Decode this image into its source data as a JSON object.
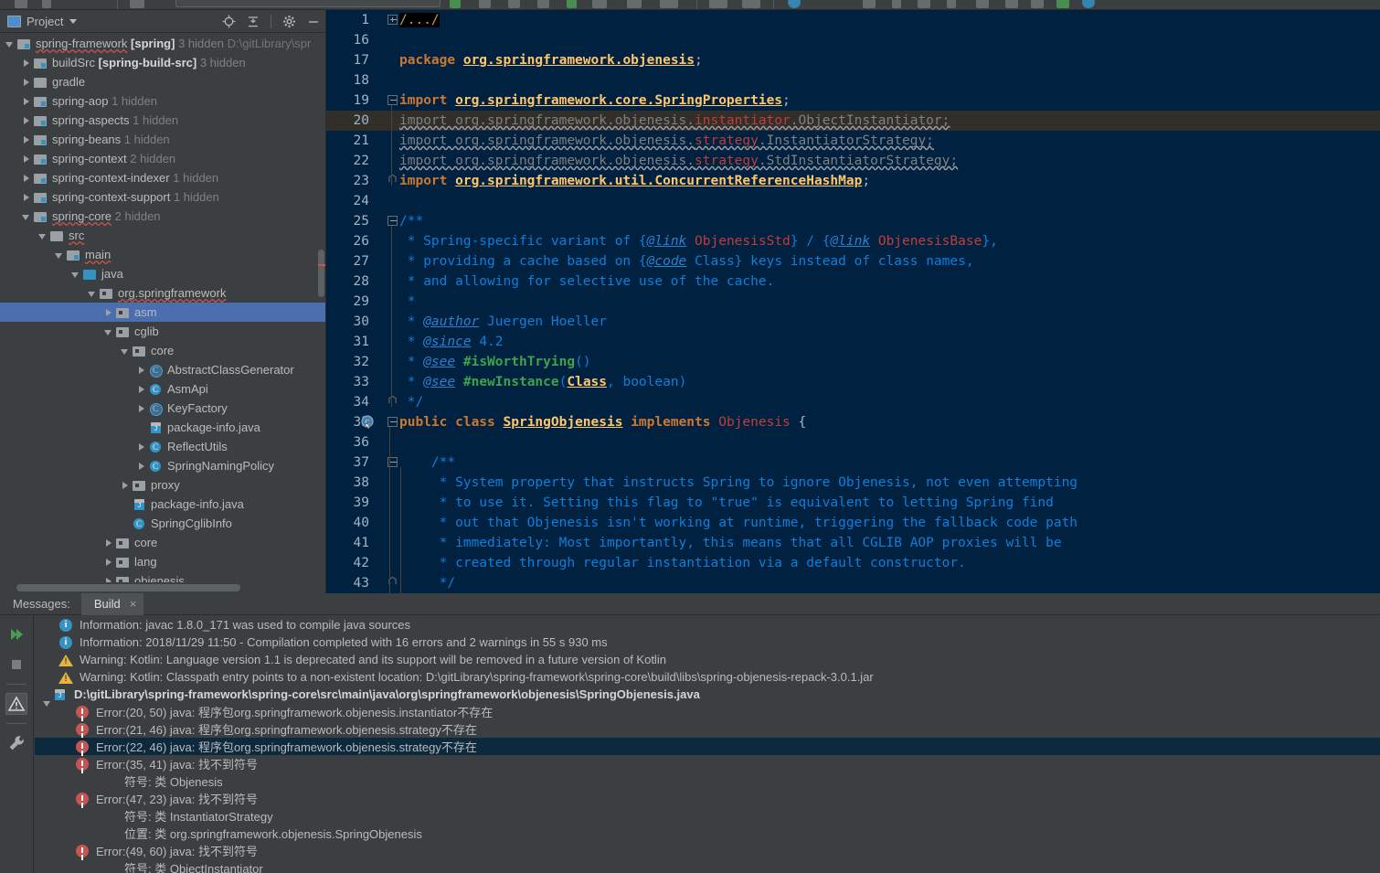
{
  "project_panel": {
    "title": "Project",
    "icons": [
      "project-window-icon",
      "caret-down-icon",
      "locate-icon",
      "collapse-all-icon",
      "gear-icon",
      "hide-icon"
    ],
    "tree": [
      {
        "depth": 0,
        "state": "open",
        "icon": "module-icon",
        "name": "spring-framework",
        "bracket": "[spring]",
        "hidden": "3 hidden",
        "path": "D:\\gitLibrary\\spr",
        "squiggle": true
      },
      {
        "depth": 1,
        "state": "closed",
        "icon": "module-icon",
        "name": "buildSrc",
        "bracket": "[spring-build-src]",
        "hidden": "3 hidden"
      },
      {
        "depth": 1,
        "state": "closed",
        "icon": "folder-icon",
        "name": "gradle"
      },
      {
        "depth": 1,
        "state": "closed",
        "icon": "module-icon",
        "name": "spring-aop",
        "hidden": "1 hidden"
      },
      {
        "depth": 1,
        "state": "closed",
        "icon": "module-icon",
        "name": "spring-aspects",
        "hidden": "1 hidden"
      },
      {
        "depth": 1,
        "state": "closed",
        "icon": "module-icon",
        "name": "spring-beans",
        "hidden": "1 hidden"
      },
      {
        "depth": 1,
        "state": "closed",
        "icon": "module-icon",
        "name": "spring-context",
        "hidden": "2 hidden"
      },
      {
        "depth": 1,
        "state": "closed",
        "icon": "module-icon",
        "name": "spring-context-indexer",
        "hidden": "1 hidden"
      },
      {
        "depth": 1,
        "state": "closed",
        "icon": "module-icon",
        "name": "spring-context-support",
        "hidden": "1 hidden"
      },
      {
        "depth": 1,
        "state": "open",
        "icon": "module-icon",
        "name": "spring-core",
        "hidden": "2 hidden",
        "squiggle": true
      },
      {
        "depth": 2,
        "state": "open",
        "icon": "folder-icon",
        "name": "src",
        "squiggle": true
      },
      {
        "depth": 3,
        "state": "open",
        "icon": "module-icon",
        "name": "main",
        "squiggle": true
      },
      {
        "depth": 4,
        "state": "open",
        "icon": "folder-blue-icon",
        "name": "java"
      },
      {
        "depth": 5,
        "state": "open",
        "icon": "package-icon",
        "name": "org.springframework",
        "squiggle": true
      },
      {
        "depth": 6,
        "state": "closed",
        "icon": "package-icon",
        "name": "asm",
        "selected": true
      },
      {
        "depth": 6,
        "state": "open",
        "icon": "package-icon",
        "name": "cglib"
      },
      {
        "depth": 7,
        "state": "open",
        "icon": "package-icon",
        "name": "core"
      },
      {
        "depth": 8,
        "state": "closed",
        "icon": "class-abstract-icon",
        "name": "AbstractClassGenerator"
      },
      {
        "depth": 8,
        "state": "closed",
        "icon": "class-icon",
        "name": "AsmApi"
      },
      {
        "depth": 8,
        "state": "closed",
        "icon": "class-abstract-icon",
        "name": "KeyFactory"
      },
      {
        "depth": 8,
        "state": "none",
        "icon": "java-file-icon",
        "name": "package-info.java"
      },
      {
        "depth": 8,
        "state": "closed",
        "icon": "class-icon",
        "name": "ReflectUtils"
      },
      {
        "depth": 8,
        "state": "closed",
        "icon": "class-icon",
        "name": "SpringNamingPolicy"
      },
      {
        "depth": 7,
        "state": "closed",
        "icon": "package-icon",
        "name": "proxy"
      },
      {
        "depth": 7,
        "state": "none",
        "icon": "java-file-icon",
        "name": "package-info.java"
      },
      {
        "depth": 7,
        "state": "none",
        "icon": "class-icon",
        "name": "SpringCglibInfo"
      },
      {
        "depth": 6,
        "state": "closed",
        "icon": "package-icon",
        "name": "core"
      },
      {
        "depth": 6,
        "state": "closed",
        "icon": "package-icon",
        "name": "lang"
      },
      {
        "depth": 6,
        "state": "closed",
        "icon": "package-icon",
        "name": "objenesis",
        "squiggle": true
      }
    ]
  },
  "editor": {
    "file": "SpringObjenesis.java",
    "current_line": 20,
    "lines": [
      {
        "num": "1",
        "fold": "plus",
        "segments": [
          {
            "t": "/.../",
            "c": "fold-ph"
          }
        ]
      },
      {
        "num": "16",
        "segments": []
      },
      {
        "num": "17",
        "segments": [
          {
            "t": "package ",
            "c": "kw"
          },
          {
            "t": "org.springframework.objenesis",
            "c": "pkgref"
          },
          {
            "t": ";",
            "c": "punc"
          }
        ]
      },
      {
        "num": "18",
        "segments": []
      },
      {
        "num": "19",
        "fold": "top",
        "segments": [
          {
            "t": "import ",
            "c": "kw"
          },
          {
            "t": "org.springframework.core.SpringProperties",
            "c": "pkgref"
          },
          {
            "t": ";",
            "c": "punc"
          }
        ]
      },
      {
        "num": "20",
        "current": true,
        "segments": [
          {
            "t": "import org.springframework.objenesis.",
            "c": "err-import wavy"
          },
          {
            "t": "instantiator",
            "c": "err-red wavy"
          },
          {
            "t": ".ObjectInstantiator;",
            "c": "err-import wavy"
          }
        ]
      },
      {
        "num": "21",
        "segments": [
          {
            "t": "import org.springframework.objenesis.",
            "c": "err-import wavy"
          },
          {
            "t": "strategy",
            "c": "err-red wavy"
          },
          {
            "t": ".InstantiatorStrategy;",
            "c": "err-import wavy"
          }
        ]
      },
      {
        "num": "22",
        "segments": [
          {
            "t": "import org.springframework.objenesis.",
            "c": "err-import wavy"
          },
          {
            "t": "strategy",
            "c": "err-red wavy"
          },
          {
            "t": ".StdInstantiatorStrategy;",
            "c": "err-import wavy"
          }
        ]
      },
      {
        "num": "23",
        "fold": "end",
        "segments": [
          {
            "t": "import ",
            "c": "kw"
          },
          {
            "t": "org.springframework.util.ConcurrentReferenceHashMap",
            "c": "pkgref"
          },
          {
            "t": ";",
            "c": "punc"
          }
        ]
      },
      {
        "num": "24",
        "segments": []
      },
      {
        "num": "25",
        "fold": "top",
        "segments": [
          {
            "t": "/**",
            "c": "cmt"
          }
        ]
      },
      {
        "num": "26",
        "segments": [
          {
            "t": " * Spring-specific variant of ",
            "c": "cmt"
          },
          {
            "t": "{",
            "c": "cmt"
          },
          {
            "t": "@link",
            "c": "cmt-tag"
          },
          {
            "t": " ",
            "c": "cmt"
          },
          {
            "t": "ObjenesisStd",
            "c": "cmt-link"
          },
          {
            "t": "} / {",
            "c": "cmt"
          },
          {
            "t": "@link",
            "c": "cmt-tag"
          },
          {
            "t": " ",
            "c": "cmt"
          },
          {
            "t": "ObjenesisBase",
            "c": "cmt-link"
          },
          {
            "t": "},",
            "c": "cmt"
          }
        ]
      },
      {
        "num": "27",
        "segments": [
          {
            "t": " * providing a cache based on ",
            "c": "cmt"
          },
          {
            "t": "{",
            "c": "cmt"
          },
          {
            "t": "@code",
            "c": "cmt-tag"
          },
          {
            "t": " Class} keys instead of class names,",
            "c": "cmt"
          }
        ]
      },
      {
        "num": "28",
        "segments": [
          {
            "t": " * and allowing for selective use of the cache.",
            "c": "cmt"
          }
        ]
      },
      {
        "num": "29",
        "segments": [
          {
            "t": " *",
            "c": "cmt"
          }
        ]
      },
      {
        "num": "30",
        "segments": [
          {
            "t": " * ",
            "c": "cmt"
          },
          {
            "t": "@author",
            "c": "cmt-tag"
          },
          {
            "t": " Juergen Hoeller",
            "c": "cmt"
          }
        ]
      },
      {
        "num": "31",
        "segments": [
          {
            "t": " * ",
            "c": "cmt"
          },
          {
            "t": "@since",
            "c": "cmt-tag"
          },
          {
            "t": " 4.2",
            "c": "cmt"
          }
        ]
      },
      {
        "num": "32",
        "segments": [
          {
            "t": " * ",
            "c": "cmt"
          },
          {
            "t": "@see",
            "c": "cmt-tag"
          },
          {
            "t": " ",
            "c": "cmt"
          },
          {
            "t": "#isWorthTrying",
            "c": "cmt-meth"
          },
          {
            "t": "()",
            "c": "cmt"
          }
        ]
      },
      {
        "num": "33",
        "segments": [
          {
            "t": " * ",
            "c": "cmt"
          },
          {
            "t": "@see",
            "c": "cmt-tag"
          },
          {
            "t": " ",
            "c": "cmt"
          },
          {
            "t": "#newInstance",
            "c": "cmt-meth"
          },
          {
            "t": "(",
            "c": "cmt"
          },
          {
            "t": "Class",
            "c": "cmt-cls"
          },
          {
            "t": ", boolean)",
            "c": "cmt"
          }
        ]
      },
      {
        "num": "34",
        "fold": "end",
        "segments": [
          {
            "t": " */",
            "c": "cmt"
          }
        ]
      },
      {
        "num": "35",
        "marker": "class-marker-icon",
        "fold": "top",
        "segments": [
          {
            "t": "public class ",
            "c": "kw"
          },
          {
            "t": "SpringObjenesis",
            "c": "cls-decl"
          },
          {
            "t": " ",
            "c": "sem"
          },
          {
            "t": "implements ",
            "c": "kw"
          },
          {
            "t": "Objenesis",
            "c": "type-red"
          },
          {
            "t": " {",
            "c": "sem"
          }
        ]
      },
      {
        "num": "36",
        "segments": []
      },
      {
        "num": "37",
        "fold": "top",
        "indent": 1,
        "segments": [
          {
            "t": "    /**",
            "c": "cmt"
          }
        ]
      },
      {
        "num": "38",
        "indent": 1,
        "segments": [
          {
            "t": "     * System property that instructs Spring to ignore Objenesis, not even attempting",
            "c": "cmt"
          }
        ]
      },
      {
        "num": "39",
        "indent": 1,
        "segments": [
          {
            "t": "     * to use it. Setting this flag to \"true\" is equivalent to letting Spring find",
            "c": "cmt"
          }
        ]
      },
      {
        "num": "40",
        "indent": 1,
        "segments": [
          {
            "t": "     * out that Objenesis isn't working at runtime, triggering the fallback code path",
            "c": "cmt"
          }
        ]
      },
      {
        "num": "41",
        "indent": 1,
        "segments": [
          {
            "t": "     * immediately: Most importantly, this means that all CGLIB AOP proxies will be",
            "c": "cmt"
          }
        ]
      },
      {
        "num": "42",
        "indent": 1,
        "segments": [
          {
            "t": "     * created through regular instantiation via a default constructor.",
            "c": "cmt"
          }
        ]
      },
      {
        "num": "43",
        "fold": "end",
        "indent": 1,
        "segments": [
          {
            "t": "     */",
            "c": "cmt"
          }
        ]
      }
    ]
  },
  "messages": {
    "label": "Messages:",
    "tab": "Build",
    "close_label": "×",
    "toolbar_icons": [
      "rerun-icon",
      "stop-icon",
      "warnings-filter-icon",
      "settings-wrench-icon"
    ],
    "rows": [
      {
        "indent": 1,
        "icon": "info-icon",
        "text": "Information: javac 1.8.0_171 was used to compile java sources"
      },
      {
        "indent": 1,
        "icon": "info-icon",
        "text": "Information: 2018/11/29 11:50 - Compilation completed with 16 errors and 2 warnings in 55 s 930 ms"
      },
      {
        "indent": 1,
        "icon": "warning-icon",
        "text": "Warning: Kotlin: Language version 1.1 is deprecated and its support will be removed in a future version of Kotlin"
      },
      {
        "indent": 1,
        "icon": "warning-icon",
        "text": "Warning: Kotlin: Classpath entry points to a non-existent location: D:\\gitLibrary\\spring-framework\\spring-core\\build\\libs\\spring-objenesis-repack-3.0.1.jar"
      },
      {
        "indent": 0,
        "arrow": "open",
        "icon": "java-file-icon",
        "bold": true,
        "text": "D:\\gitLibrary\\spring-framework\\spring-core\\src\\main\\java\\org\\springframework\\objenesis\\SpringObjenesis.java"
      },
      {
        "indent": 2,
        "icon": "error-icon",
        "text": "Error:(20, 50)  java: 程序包org.springframework.objenesis.instantiator不存在"
      },
      {
        "indent": 2,
        "icon": "error-icon",
        "text": "Error:(21, 46)  java: 程序包org.springframework.objenesis.strategy不存在"
      },
      {
        "indent": 2,
        "icon": "error-icon",
        "selected": true,
        "text": "Error:(22, 46)  java: 程序包org.springframework.objenesis.strategy不存在"
      },
      {
        "indent": 2,
        "icon": "error-icon",
        "text": "Error:(35, 41)  java: 找不到符号"
      },
      {
        "indent": 5,
        "text": "符号: 类 Objenesis"
      },
      {
        "indent": 2,
        "icon": "error-icon",
        "text": "Error:(47, 23)  java: 找不到符号"
      },
      {
        "indent": 5,
        "text": "符号:  类 InstantiatorStrategy"
      },
      {
        "indent": 5,
        "text": "位置: 类 org.springframework.objenesis.SpringObjenesis"
      },
      {
        "indent": 2,
        "icon": "error-icon",
        "text": "Error:(49, 60)  java: 找不到符号"
      },
      {
        "indent": 5,
        "text": "符号:  类 ObjectInstantiator"
      }
    ]
  },
  "colors": {
    "editor_bg": "#002240",
    "panel_bg": "#3c3f41",
    "selection": "#4b6eaf",
    "accent": "#3592c4",
    "error": "#c75450",
    "warning": "#e8b33d",
    "keyword": "#cc7832",
    "comment": "#0e7fdb"
  }
}
